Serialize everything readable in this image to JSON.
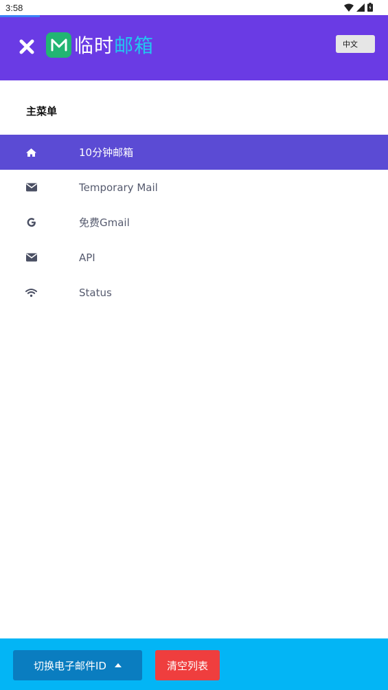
{
  "status_bar": {
    "time": "3:58"
  },
  "header": {
    "logo_part1": "临时",
    "logo_part2": "邮箱",
    "language_label": "中文"
  },
  "menu": {
    "title": "主菜单",
    "items": [
      {
        "label": "10分钟邮箱",
        "icon": "home-icon",
        "active": true
      },
      {
        "label": "Temporary Mail",
        "icon": "envelope-icon",
        "active": false
      },
      {
        "label": "免费Gmail",
        "icon": "google-icon",
        "active": false
      },
      {
        "label": "API",
        "icon": "envelope-icon",
        "active": false
      },
      {
        "label": "Status",
        "icon": "wifi-icon",
        "active": false
      }
    ]
  },
  "footer": {
    "switch_label": "切换电子邮件ID",
    "clear_label": "清空列表"
  },
  "colors": {
    "header": "#6a3be4",
    "active_item": "#5b4bd4",
    "footer": "#03b5f5",
    "switch_button": "#0a7dc0",
    "clear_button": "#ef3e3e",
    "logo_green": "#22b573",
    "logo_accent": "#22c7f0"
  }
}
